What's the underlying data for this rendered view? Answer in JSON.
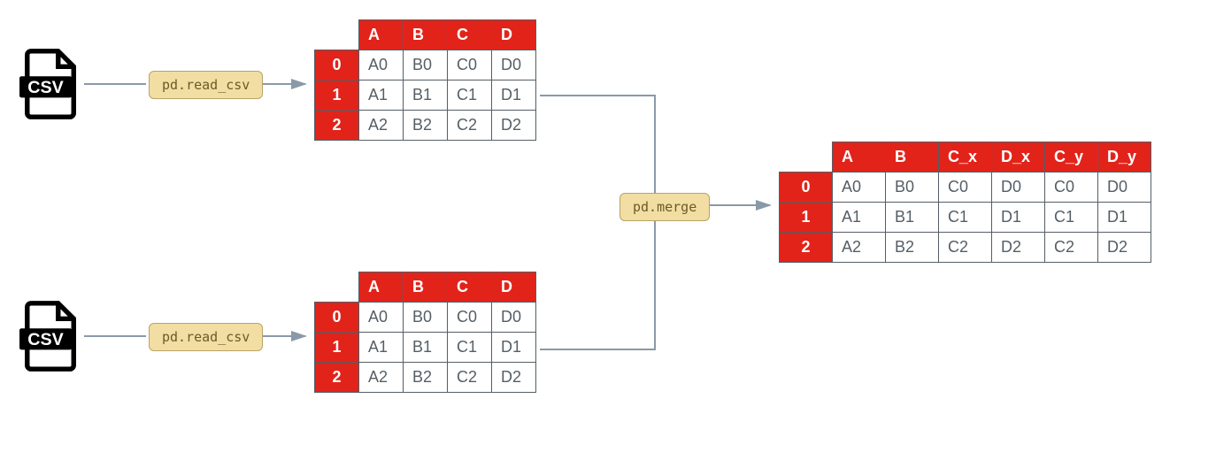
{
  "csv_label": "CSV",
  "badges": {
    "read_csv_1": "pd.read_csv",
    "read_csv_2": "pd.read_csv",
    "merge": "pd.merge"
  },
  "df1": {
    "cols": [
      "A",
      "B",
      "C",
      "D"
    ],
    "idx": [
      "0",
      "1",
      "2"
    ],
    "rows": [
      [
        "A0",
        "B0",
        "C0",
        "D0"
      ],
      [
        "A1",
        "B1",
        "C1",
        "D1"
      ],
      [
        "A2",
        "B2",
        "C2",
        "D2"
      ]
    ]
  },
  "df2": {
    "cols": [
      "A",
      "B",
      "C",
      "D"
    ],
    "idx": [
      "0",
      "1",
      "2"
    ],
    "rows": [
      [
        "A0",
        "B0",
        "C0",
        "D0"
      ],
      [
        "A1",
        "B1",
        "C1",
        "D1"
      ],
      [
        "A2",
        "B2",
        "C2",
        "D2"
      ]
    ]
  },
  "merged": {
    "cols": [
      "A",
      "B",
      "C_x",
      "D_x",
      "C_y",
      "D_y"
    ],
    "idx": [
      "0",
      "1",
      "2"
    ],
    "rows": [
      [
        "A0",
        "B0",
        "C0",
        "D0",
        "C0",
        "D0"
      ],
      [
        "A1",
        "B1",
        "C1",
        "D1",
        "C1",
        "D1"
      ],
      [
        "A2",
        "B2",
        "C2",
        "D2",
        "C2",
        "D2"
      ]
    ]
  },
  "colors": {
    "header": "#e2231a",
    "badge_bg": "#f2dea2",
    "badge_border": "#b9a36a",
    "connector": "#8a99a8"
  }
}
